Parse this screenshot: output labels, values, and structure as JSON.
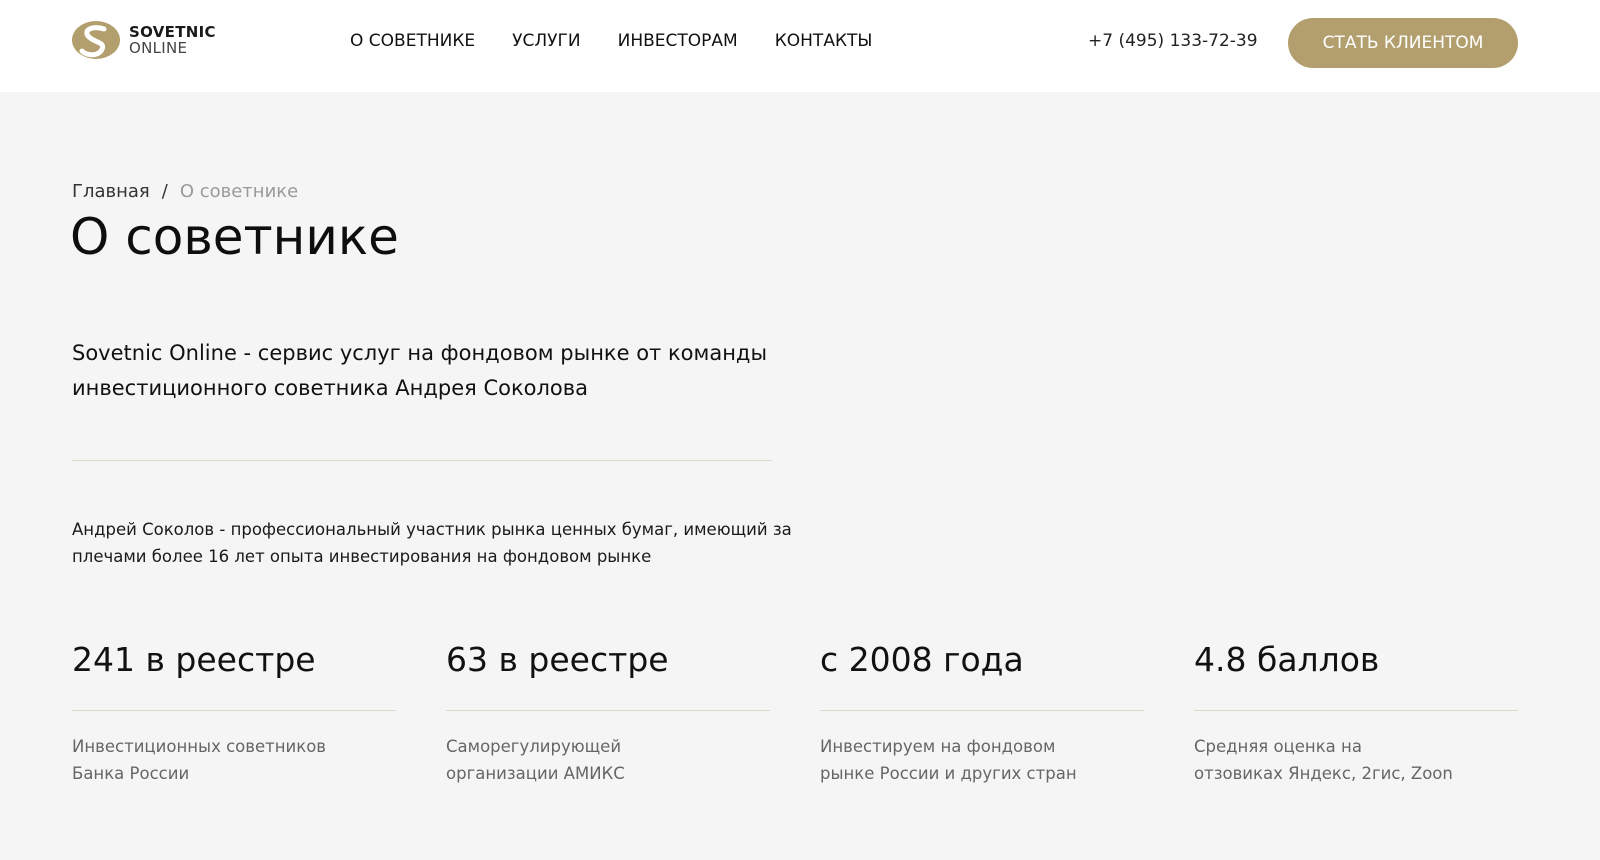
{
  "logo": {
    "line1": "SOVETNIC",
    "line2": "ONLINE"
  },
  "nav": {
    "items": [
      {
        "label": "О СОВЕТНИКЕ"
      },
      {
        "label": "УСЛУГИ"
      },
      {
        "label": "ИНВЕСТОРАМ"
      },
      {
        "label": "КОНТАКТЫ"
      }
    ]
  },
  "header": {
    "phone": "+7 (495) 133-72-39",
    "cta_label": "СТАТЬ КЛИЕНТОМ"
  },
  "breadcrumb": {
    "home": "Главная",
    "separator": "/",
    "current": "О советнике"
  },
  "page": {
    "title": "О советнике",
    "lead": "Sovetnic Online - сервис услуг на фондовом рынке от команды инвестиционного советника Андрея Соколова",
    "bio": "Андрей Соколов - профессиональный участник рынка ценных бумаг, имеющий за плечами более 16 лет опыта инвестирования на фондовом рынке"
  },
  "stats": [
    {
      "value": "241 в реестре",
      "desc": "Инвестиционных советников Банка России"
    },
    {
      "value": "63 в реестре",
      "desc": "Саморегулирующей организации АМИКС"
    },
    {
      "value": "с 2008 года",
      "desc": "Инвестируем на фондовом рынке России и других стран"
    },
    {
      "value": "4.8 баллов",
      "desc": "Средняя оценка на отзовиках Яндекс, 2гис, Zoon"
    }
  ],
  "colors": {
    "accent": "#b39f6e",
    "background": "#f5f5f5",
    "header_bg": "#ffffff",
    "divider": "#ddd8c8"
  }
}
